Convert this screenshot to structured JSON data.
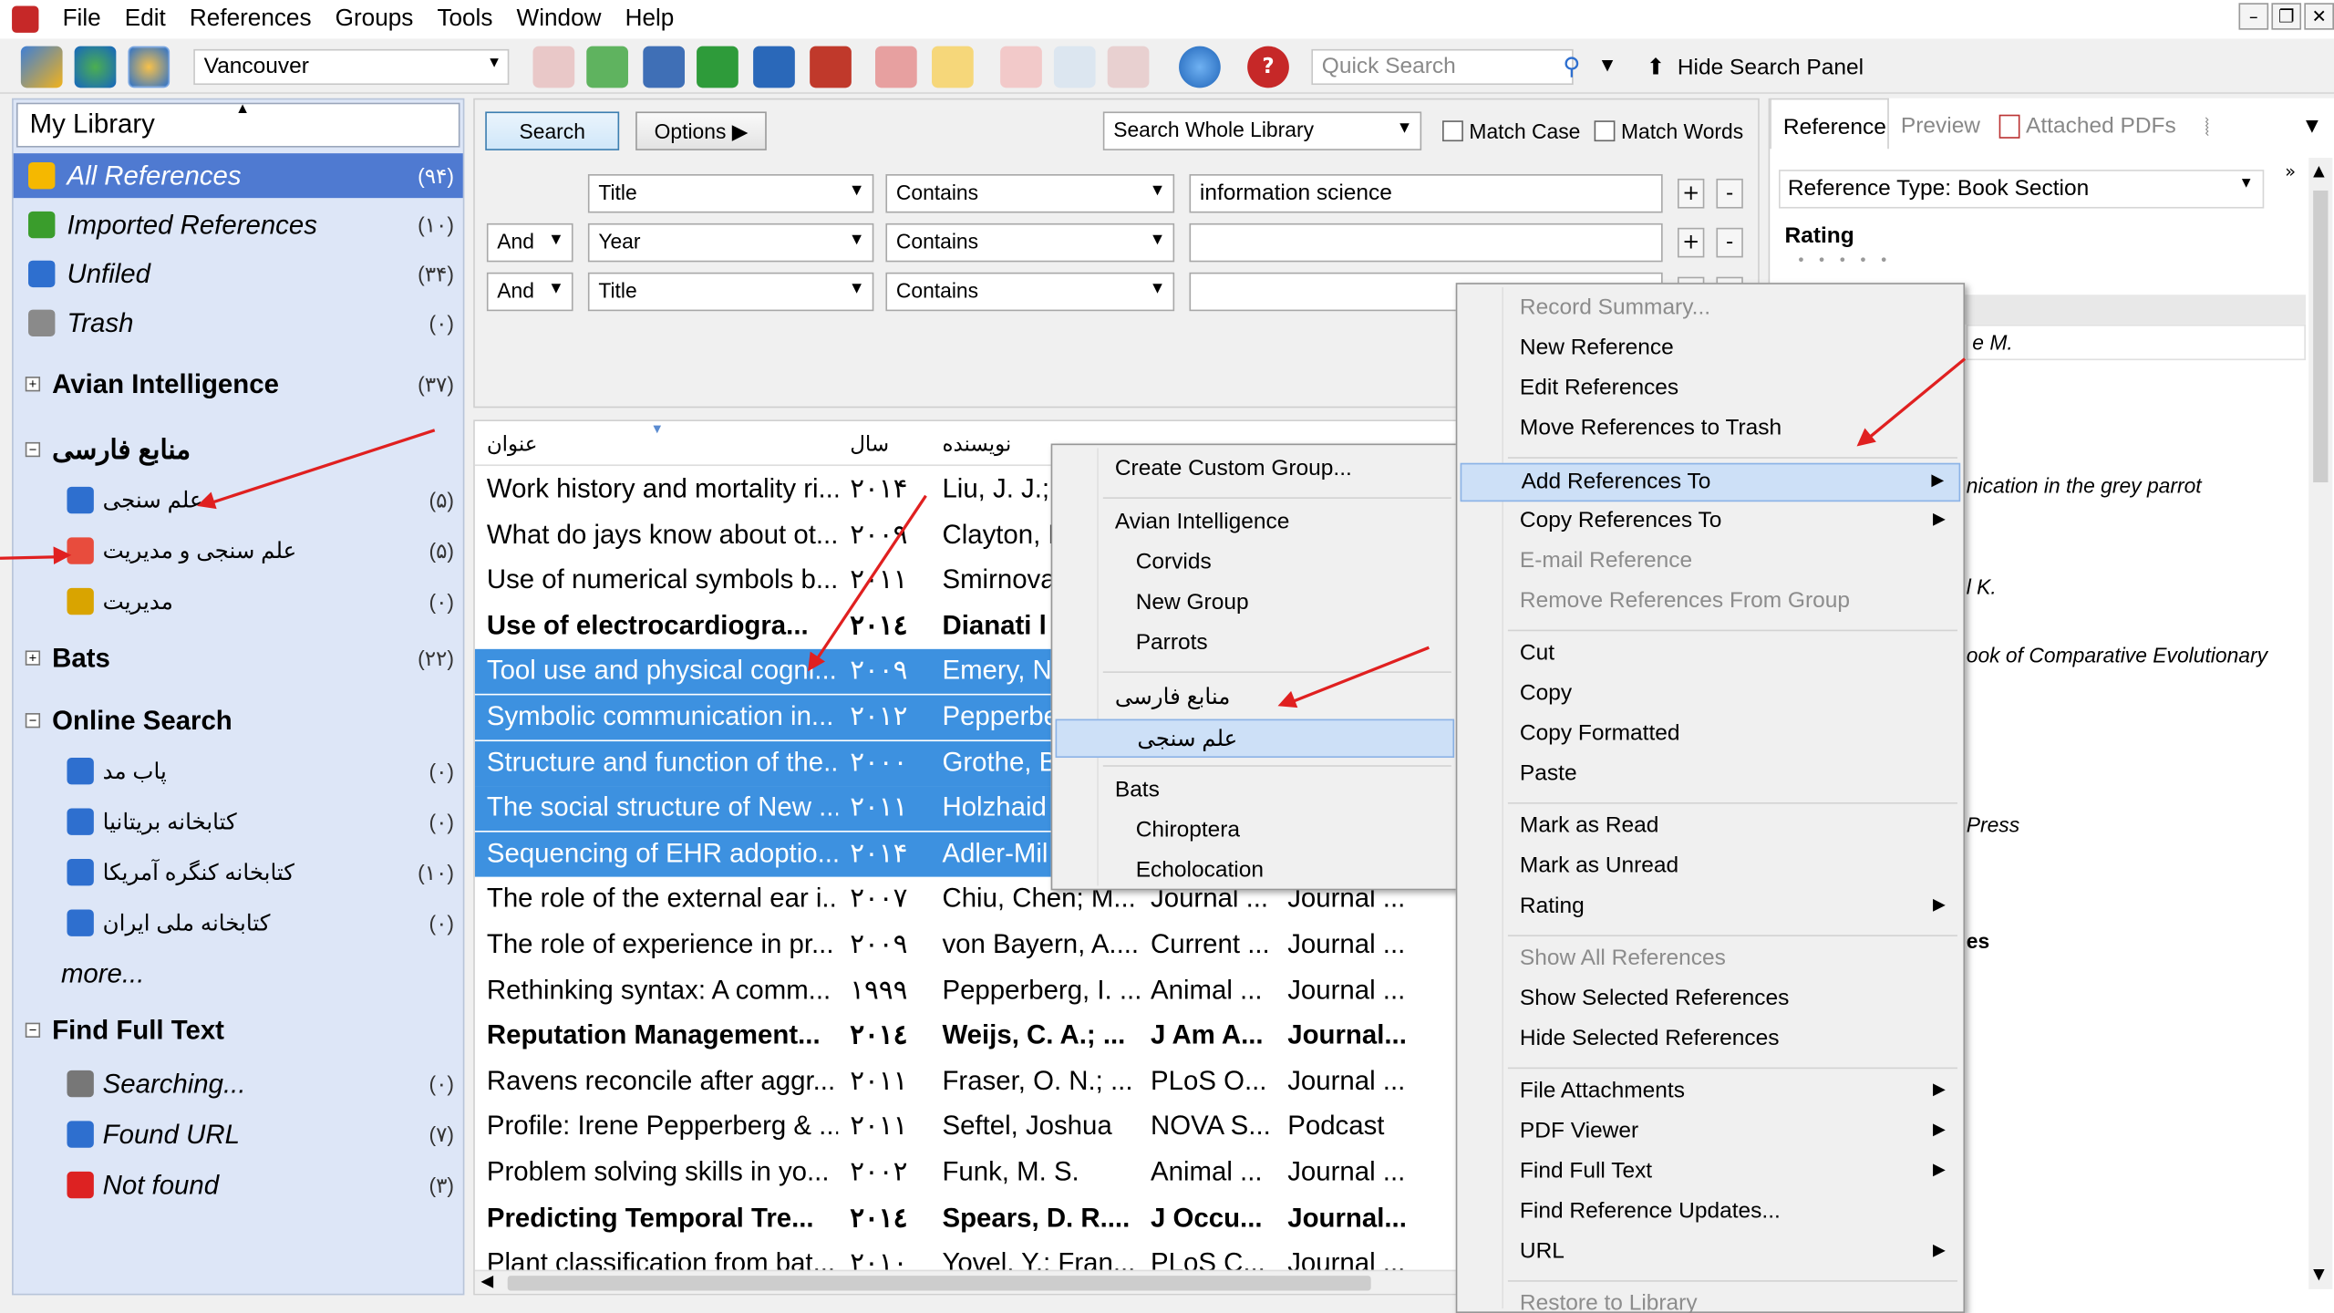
{
  "menubar": {
    "items": [
      "File",
      "Edit",
      "References",
      "Groups",
      "Tools",
      "Window",
      "Help"
    ]
  },
  "toolbar": {
    "style": "Vancouver",
    "quick_search_placeholder": "Quick Search",
    "hide_panel": "Hide Search Panel",
    "icons": [
      "import-icon",
      "online-icon",
      "integrated-icon",
      "copy-ref-icon",
      "new-ref-icon",
      "search-ref-icon",
      "insert-icon",
      "export-icon",
      "web-icon",
      "find-pdf-icon",
      "open-pdf-icon",
      "open-folder-icon",
      "format-paper-icon",
      "cite-while-write-icon",
      "sync-icon",
      "help-icon"
    ]
  },
  "library": {
    "title": "My Library",
    "items": [
      {
        "label": "All References",
        "count": "(۹۴)",
        "color": "#f5b800"
      },
      {
        "label": "Imported References",
        "count": "(۱۰)",
        "color": "#3a9d2c"
      },
      {
        "label": "Unfiled",
        "count": "(۳۴)",
        "color": "#2e6fcf"
      },
      {
        "label": "Trash",
        "count": "(۰)",
        "color": "#8a8a8a"
      }
    ],
    "groups": [
      {
        "label": "Avian Intelligence",
        "count": "(۳۷)",
        "children": []
      },
      {
        "label": "منابع فارسی",
        "count": "",
        "children": [
          {
            "label": "علم سنجی",
            "count": "(۵)",
            "color": "#2e6fcf"
          },
          {
            "label": "علم سنجی و مدیریت",
            "count": "(۵)",
            "color": "#e84c3d"
          },
          {
            "label": "مدیریت",
            "count": "(۰)",
            "color": "#d9a400"
          }
        ]
      },
      {
        "label": "Bats",
        "count": "(۲۲)",
        "children": []
      },
      {
        "label": "Online Search",
        "count": "",
        "children": [
          {
            "label": "پاب مد",
            "count": "(۰)",
            "color": "#2e6fcf"
          },
          {
            "label": "کتابخانه بریتانیا",
            "count": "(۰)",
            "color": "#2e6fcf"
          },
          {
            "label": "کتابخانه کنگره آمریکا",
            "count": "(۱۰)",
            "color": "#2e6fcf"
          },
          {
            "label": "کتابخانه ملی ایران",
            "count": "(۰)",
            "color": "#2e6fcf"
          },
          {
            "label": "more...",
            "count": "",
            "color": ""
          }
        ]
      },
      {
        "label": "Find Full Text",
        "count": "",
        "children": [
          {
            "label": "Searching...",
            "count": "(۰)",
            "color": "#777"
          },
          {
            "label": "Found URL",
            "count": "(۷)",
            "color": "#2e6fcf"
          },
          {
            "label": "Not found",
            "count": "(۳)",
            "color": "#d22"
          }
        ]
      }
    ]
  },
  "search": {
    "search_btn": "Search",
    "options_btn": "Options",
    "scope": "Search Whole Library",
    "match_case": "Match Case",
    "match_words": "Match Words",
    "rows": [
      {
        "bool": "",
        "field": "Title",
        "op": "Contains",
        "value": "information science"
      },
      {
        "bool": "And",
        "field": "Year",
        "op": "Contains",
        "value": ""
      },
      {
        "bool": "And",
        "field": "Title",
        "op": "Contains",
        "value": ""
      }
    ]
  },
  "reflist": {
    "headers": [
      "عنوان",
      "سال",
      "نویسنده"
    ],
    "rows": [
      {
        "title": "Work history and mortality ri...",
        "year": "۲۰۱۴",
        "author": "Liu, J. J.;",
        "col4": "",
        "col5": "",
        "hl": false,
        "bold": false
      },
      {
        "title": "What do jays know about ot...",
        "year": "۲۰۰۹",
        "author": "Clayton, N",
        "col4": "",
        "col5": "",
        "hl": false,
        "bold": false
      },
      {
        "title": "Use of numerical symbols b...",
        "year": "۲۰۱۱",
        "author": "Smirnova",
        "col4": "",
        "col5": "",
        "hl": false,
        "bold": false
      },
      {
        "title": "Use of electrocardiogra...",
        "year": "۲۰۱٤",
        "author": "Dianati l",
        "col4": "",
        "col5": "",
        "hl": false,
        "bold": true
      },
      {
        "title": "Tool use and physical cogni...",
        "year": "۲۰۰۹",
        "author": "Emery, N",
        "col4": "",
        "col5": "",
        "hl": true,
        "bold": false
      },
      {
        "title": "Symbolic communication in...",
        "year": "۲۰۱۲",
        "author": "Pepperbe",
        "col4": "",
        "col5": "",
        "hl": true,
        "bold": false
      },
      {
        "title": "Structure and function of the...",
        "year": "۲۰۰۰",
        "author": "Grothe, B",
        "col4": "",
        "col5": "",
        "hl": true,
        "bold": false
      },
      {
        "title": "The social structure of New ...",
        "year": "۲۰۱۱",
        "author": "Holzhaid",
        "col4": "",
        "col5": "",
        "hl": true,
        "bold": false
      },
      {
        "title": "Sequencing of EHR adoptio...",
        "year": "۲۰۱۴",
        "author": "Adler-Mil",
        "col4": "",
        "col5": "",
        "hl": true,
        "bold": false
      },
      {
        "title": "The role of the external ear i...",
        "year": "۲۰۰۷",
        "author": "Chiu, Chen; M...",
        "col4": "Journal ...",
        "col5": "Journal ...",
        "hl": false,
        "bold": false
      },
      {
        "title": "The role of experience in pr...",
        "year": "۲۰۰۹",
        "author": "von Bayern, A....",
        "col4": "Current ...",
        "col5": "Journal ...",
        "hl": false,
        "bold": false
      },
      {
        "title": "Rethinking syntax: A comm...",
        "year": "۱۹۹۹",
        "author": "Pepperberg, I. ...",
        "col4": "Animal ...",
        "col5": "Journal ...",
        "hl": false,
        "bold": false
      },
      {
        "title": "Reputation Management...",
        "year": "۲۰۱٤",
        "author": "Weijs, C. A.; ...",
        "col4": "J Am A...",
        "col5": "Journal...",
        "hl": false,
        "bold": true
      },
      {
        "title": "Ravens reconcile after aggr...",
        "year": "۲۰۱۱",
        "author": "Fraser, O. N.; ...",
        "col4": "PLoS O...",
        "col5": "Journal ...",
        "hl": false,
        "bold": false
      },
      {
        "title": "Profile: Irene Pepperberg & ...",
        "year": "۲۰۱۱",
        "author": "Seftel, Joshua",
        "col4": "NOVA S...",
        "col5": "Podcast",
        "hl": false,
        "bold": false
      },
      {
        "title": "Problem solving skills in yo...",
        "year": "۲۰۰۲",
        "author": "Funk, M. S.",
        "col4": "Animal ...",
        "col5": "Journal ...",
        "hl": false,
        "bold": false
      },
      {
        "title": "Predicting Temporal Tre...",
        "year": "۲۰۱٤",
        "author": "Spears, D. R....",
        "col4": "J Occu...",
        "col5": "Journal...",
        "hl": false,
        "bold": true
      },
      {
        "title": "Plant classification from bat...",
        "year": "۲۰۱۰",
        "author": "Yovel, Y.; Fran...",
        "col4": "PLoS C...",
        "col5": "Journal ...",
        "hl": false,
        "bold": false
      }
    ]
  },
  "rightpanel": {
    "tabs": [
      "Reference",
      "Preview",
      "Attached PDFs"
    ],
    "ref_type_label": "Reference Type:",
    "ref_type": "Book Section",
    "rating_label": "Rating",
    "snippets": [
      "e M.",
      "nication in the grey parrot",
      "l K.",
      "ook of Comparative Evolutionary",
      "Press",
      "es"
    ]
  },
  "context_menu": {
    "items": [
      {
        "label": "Record Summary...",
        "dis": true,
        "arrow": false
      },
      {
        "label": "New Reference",
        "dis": false,
        "arrow": false
      },
      {
        "label": "Edit References",
        "dis": false,
        "arrow": false
      },
      {
        "label": "Move References to Trash",
        "dis": false,
        "arrow": false
      },
      {
        "label": "Add References To",
        "dis": false,
        "arrow": true,
        "act": true
      },
      {
        "label": "Copy References To",
        "dis": false,
        "arrow": true
      },
      {
        "label": "E-mail Reference",
        "dis": true,
        "arrow": false
      },
      {
        "label": "Remove References From Group",
        "dis": true,
        "arrow": false
      },
      {
        "label": "Cut",
        "dis": false,
        "arrow": false
      },
      {
        "label": "Copy",
        "dis": false,
        "arrow": false
      },
      {
        "label": "Copy Formatted",
        "dis": false,
        "arrow": false
      },
      {
        "label": "Paste",
        "dis": false,
        "arrow": false
      },
      {
        "label": "Mark as Read",
        "dis": false,
        "arrow": false
      },
      {
        "label": "Mark as Unread",
        "dis": false,
        "arrow": false
      },
      {
        "label": "Rating",
        "dis": false,
        "arrow": true
      },
      {
        "label": "Show All References",
        "dis": true,
        "arrow": false
      },
      {
        "label": "Show Selected References",
        "dis": false,
        "arrow": false
      },
      {
        "label": "Hide Selected References",
        "dis": false,
        "arrow": false
      },
      {
        "label": "File Attachments",
        "dis": false,
        "arrow": true
      },
      {
        "label": "PDF Viewer",
        "dis": false,
        "arrow": true
      },
      {
        "label": "Find Full Text",
        "dis": false,
        "arrow": true
      },
      {
        "label": "Find Reference Updates...",
        "dis": false,
        "arrow": false
      },
      {
        "label": "URL",
        "dis": false,
        "arrow": true
      },
      {
        "label": "Restore to Library",
        "dis": true,
        "arrow": false
      }
    ]
  },
  "submenu": {
    "items": [
      {
        "label": "Create Custom Group...",
        "ind": false
      },
      {
        "label": "Avian Intelligence",
        "ind": false
      },
      {
        "label": "Corvids",
        "ind": true
      },
      {
        "label": "New Group",
        "ind": true
      },
      {
        "label": "Parrots",
        "ind": true
      },
      {
        "label": "منابع فارسی",
        "ind": false
      },
      {
        "label": "علم سنجی",
        "ind": true,
        "act": true
      },
      {
        "label": "Bats",
        "ind": false
      },
      {
        "label": "Chiroptera",
        "ind": true
      },
      {
        "label": "Echolocation",
        "ind": true
      }
    ]
  }
}
